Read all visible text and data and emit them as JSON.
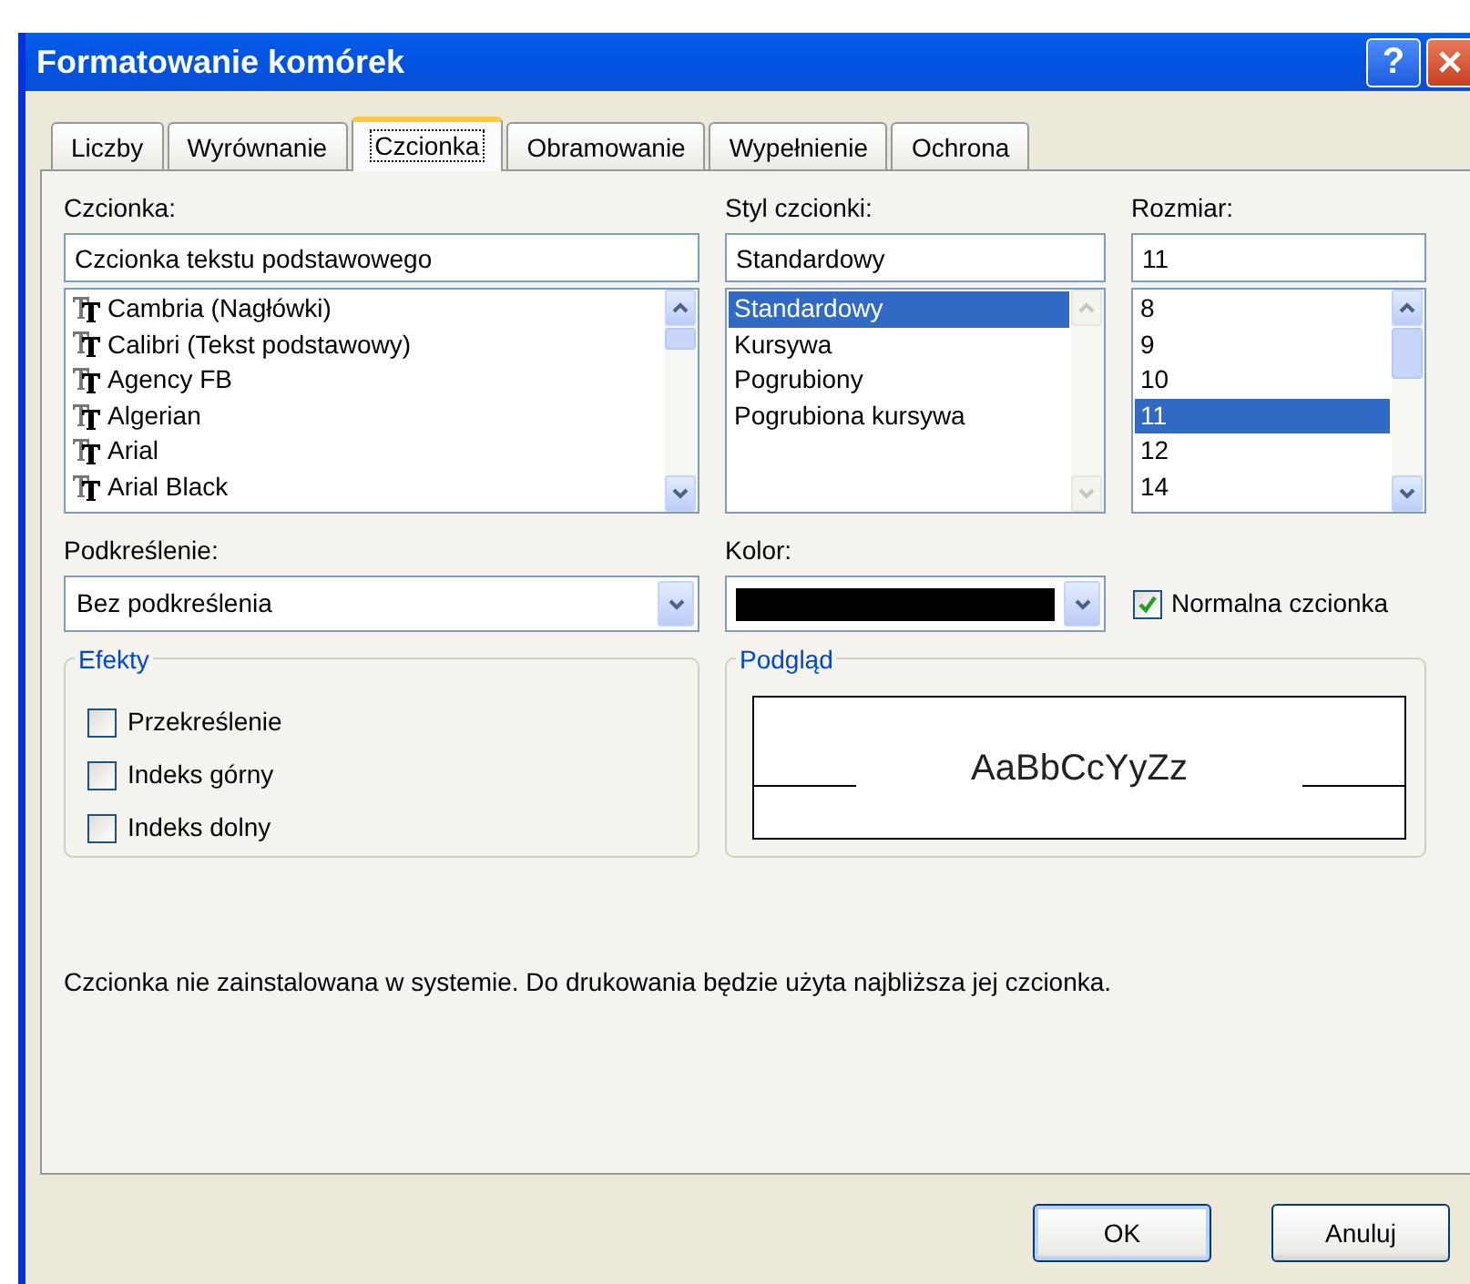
{
  "window": {
    "title": "Formatowanie komórek",
    "help_button": "?"
  },
  "tabs": [
    {
      "label": "Liczby",
      "selected": false
    },
    {
      "label": "Wyrównanie",
      "selected": false
    },
    {
      "label": "Czcionka",
      "selected": true
    },
    {
      "label": "Obramowanie",
      "selected": false
    },
    {
      "label": "Wypełnienie",
      "selected": false
    },
    {
      "label": "Ochrona",
      "selected": false
    }
  ],
  "font": {
    "label": "Czcionka:",
    "value": "Czcionka tekstu podstawowego",
    "scrollbar_disabled": false,
    "items": [
      {
        "label": "Cambria (Nagłówki)",
        "selected": false
      },
      {
        "label": "Calibri (Tekst podstawowy)",
        "selected": false
      },
      {
        "label": "Agency FB",
        "selected": false
      },
      {
        "label": "Algerian",
        "selected": false
      },
      {
        "label": "Arial",
        "selected": false
      },
      {
        "label": "Arial Black",
        "selected": false
      }
    ]
  },
  "style": {
    "label": "Styl czcionki:",
    "value": "Standardowy",
    "scrollbar_disabled": true,
    "items": [
      {
        "label": "Standardowy",
        "selected": true
      },
      {
        "label": "Kursywa",
        "selected": false
      },
      {
        "label": "Pogrubiony",
        "selected": false
      },
      {
        "label": "Pogrubiona kursywa",
        "selected": false
      }
    ]
  },
  "size": {
    "label": "Rozmiar:",
    "value": "11",
    "scrollbar_disabled": false,
    "items": [
      {
        "label": "8",
        "selected": false
      },
      {
        "label": "9",
        "selected": false
      },
      {
        "label": "10",
        "selected": false
      },
      {
        "label": "11",
        "selected": true
      },
      {
        "label": "12",
        "selected": false
      },
      {
        "label": "14",
        "selected": false
      }
    ]
  },
  "underline": {
    "label": "Podkreślenie:",
    "value": "Bez podkreślenia"
  },
  "color": {
    "label": "Kolor:",
    "color": "#000000"
  },
  "normal_font": {
    "label": "Normalna czcionka",
    "checked": true
  },
  "effects": {
    "title": "Efekty",
    "items": [
      {
        "label": "Przekreślenie",
        "checked": false
      },
      {
        "label": "Indeks górny",
        "checked": false
      },
      {
        "label": "Indeks dolny",
        "checked": false
      }
    ]
  },
  "preview": {
    "title": "Podgląd",
    "sample": "AaBbCcYyZz"
  },
  "note": "Czcionka nie zainstalowana w systemie. Do drukowania będzie użyta najbliższa jej czcionka.",
  "buttons": [
    {
      "label": "OK",
      "default": true
    },
    {
      "label": "Anuluj",
      "default": false
    }
  ]
}
